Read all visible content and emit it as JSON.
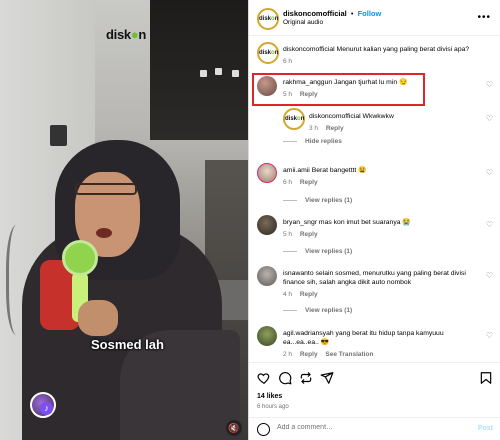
{
  "video": {
    "brand_logo": "diskon",
    "caption": "Sosmed lah"
  },
  "header": {
    "username": "diskoncomofficial",
    "separator": "•",
    "follow_label": "Follow",
    "audio": "Original audio"
  },
  "comments": [
    {
      "username": "diskoncomofficial",
      "text": "Menurut kalian yang paling berat divisi apa?",
      "time": "6 h"
    },
    {
      "username": "rakhma_anggun",
      "text": "Jangan tjurhat lu min 😏",
      "time": "5 h",
      "reply": "Reply"
    },
    {
      "username": "diskoncomofficial",
      "text": "Wkwkwkw",
      "time": "3 h",
      "reply": "Reply"
    },
    {
      "username": "amii.amii",
      "text": "Berat bangetttt 😫",
      "time": "6 h",
      "reply": "Reply"
    },
    {
      "username": "bryan_sngr",
      "text": "mas kon imut bet suaranya 😭",
      "time": "5 h",
      "reply": "Reply"
    },
    {
      "username": "isnawanto",
      "text": "selain sosmed, menurutku yang paling berat divisi finance sih, salah angka dikit auto nombok",
      "time": "4 h",
      "reply": "Reply"
    },
    {
      "username": "agil.wadriansyah",
      "text": "yang berat itu hidup tanpa kamyuuu ea...ea..ea.. 😎",
      "time": "2 h",
      "reply": "Reply",
      "translate": "See Translation"
    }
  ],
  "hide_replies": "Hide replies",
  "view_replies": [
    "View replies (1)",
    "View replies (1)",
    "View replies (1)"
  ],
  "actions": {
    "likes": "14 likes",
    "ago": "6 hours ago",
    "add_comment_placeholder": "Add a comment…",
    "post_label": "Post"
  },
  "colors": {
    "follow": "#0095f6",
    "highlight": "#e0242b",
    "post_disabled": "#b2dffc",
    "brand_green": "#6fbf2f"
  }
}
